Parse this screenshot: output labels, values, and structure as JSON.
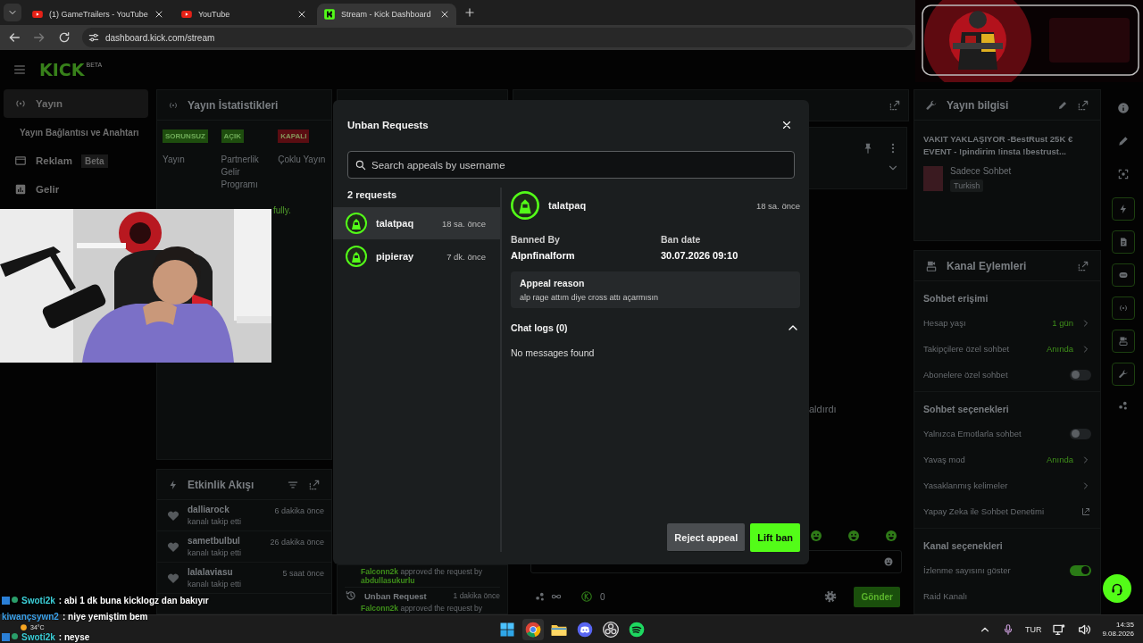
{
  "browser": {
    "tabs": [
      {
        "title": "(1) GameTrailers - YouTube",
        "kind": "youtube",
        "selected": false
      },
      {
        "title": "YouTube",
        "kind": "youtube",
        "selected": false
      },
      {
        "title": "Stream - Kick Dashboard",
        "kind": "kick",
        "selected": true
      }
    ],
    "url": "dashboard.kick.com/stream"
  },
  "header": {
    "logo": "KICK",
    "logo_badge": "BETA"
  },
  "sidebar": {
    "items": [
      {
        "label": "Yayın",
        "selected": true
      },
      {
        "label": "Yayın Bağlantısı ve Anahtarı",
        "selected": false
      },
      {
        "label": "Reklam",
        "badge": "Beta",
        "selected": false
      },
      {
        "label": "Gelir",
        "selected": false
      }
    ]
  },
  "stats_panel": {
    "title": "Yayın İstatistikleri",
    "statuses": [
      {
        "badge": "SORUNSUZ",
        "label": "Yayın",
        "color": "#1e4d0e"
      },
      {
        "badge": "AÇIK",
        "label": "Partnerlik Gelir Programı",
        "color": "#1e4d0e"
      },
      {
        "badge": "KAPALI",
        "label": "Çoklu Yayın",
        "color": "#5a0d12"
      }
    ],
    "message": "fully."
  },
  "events_panel": {
    "title": "Etkinlik Akışı",
    "items": [
      {
        "user": "dalliarock",
        "action": "kanalı takip etti",
        "time": "6 dakika önce"
      },
      {
        "user": "sametbulbul",
        "action": "kanalı takip etti",
        "time": "26 dakika önce"
      },
      {
        "user": "lalalaviasu",
        "action": "kanalı takip etti",
        "time": "5 saat önce"
      }
    ]
  },
  "mod_log": {
    "items": [
      {
        "text": "**Falconn2k** approved the request by **abdullasukurlu**"
      },
      {
        "title": "Unban Request",
        "time": "1 dakika önce",
        "text": "**Falconn2k** approved the request by"
      }
    ]
  },
  "chat_panel": {
    "partial_message": "aldırdı",
    "counter": "0",
    "send_button": "Gönder"
  },
  "info_panel": {
    "title": "Yayın bilgisi",
    "stream_title": "VAKIT YAKLAŞIYOR -BestRust 25K € EVENT - !pindirim !insta !bestrust...",
    "category": "Sadece Sohbet",
    "tag": "Turkish"
  },
  "channel_actions": {
    "title": "Kanal Eylemleri",
    "sections": [
      {
        "title": "Sohbet erişimi",
        "rows": [
          {
            "kind": "value",
            "label": "Hesap yaşı",
            "value": "1 gün"
          },
          {
            "kind": "value",
            "label": "Takipçilere özel sohbet",
            "value": "Anında"
          },
          {
            "kind": "toggle",
            "label": "Abonelere özel sohbet",
            "on": false
          }
        ]
      },
      {
        "title": "Sohbet seçenekleri",
        "rows": [
          {
            "kind": "toggle",
            "label": "Yalnızca Emotlarla sohbet",
            "on": false
          },
          {
            "kind": "value",
            "label": "Yavaş mod",
            "value": "Anında"
          },
          {
            "kind": "link",
            "label": "Yasaklanmış kelimeler"
          },
          {
            "kind": "external",
            "label": "Yapay Zeka ile Sohbet Denetimi"
          }
        ]
      },
      {
        "title": "Kanal seçenekleri",
        "rows": [
          {
            "kind": "toggle",
            "label": "İzlenme sayısını göster",
            "on": true
          },
          {
            "kind": "plain",
            "label": "Raid Kanalı"
          }
        ]
      }
    ]
  },
  "modal": {
    "title": "Unban Requests",
    "search_placeholder": "Search appeals by username",
    "count": "2 requests",
    "requests": [
      {
        "user": "talatpaq",
        "time": "18 sa. önce",
        "selected": true
      },
      {
        "user": "pipieray",
        "time": "7 dk. önce",
        "selected": false
      }
    ],
    "detail": {
      "user": "talatpaq",
      "time": "18 sa. önce",
      "fields": [
        {
          "label": "Banned By",
          "value": "Alpnfinalform"
        },
        {
          "label": "Ban date",
          "value": "30.07.2026 09:10"
        }
      ],
      "appeal_title": "Appeal reason",
      "appeal_text": "alp rage attım diye cross attı açarmısın",
      "chat_logs": {
        "title": "Chat logs (0)",
        "expanded": true,
        "empty": "No messages found"
      }
    },
    "buttons": [
      {
        "label": "Reject appeal",
        "kind": "secondary"
      },
      {
        "label": "Lift ban",
        "kind": "primary"
      }
    ]
  },
  "chat_overlay": [
    {
      "user": "Swoti2k",
      "message": ": abi 1 dk buna kicklogz dan bakıyır",
      "color": "#3ccfd8",
      "badges": true
    },
    {
      "user": "kiwançsywn2",
      "message": ": niye yemiştim bem",
      "color": "#3aa0e8",
      "badges": false
    },
    {
      "user": "Swoti2k",
      "message": ": neyse",
      "color": "#3ccfd8",
      "badges": true
    }
  ],
  "taskbar": {
    "weather": "34°C",
    "language": "TUR",
    "time": "14:35",
    "date": "9.08.2026"
  }
}
